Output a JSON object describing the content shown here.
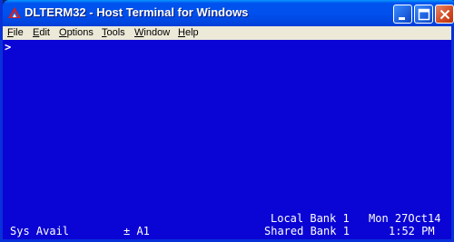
{
  "window": {
    "title": "DLTERM32 - Host Terminal for Windows",
    "icon": "delta-triangle-icon",
    "buttons": [
      "minimize-icon",
      "maximize-icon",
      "close-icon"
    ]
  },
  "menu": {
    "items": [
      {
        "first": "F",
        "rest": "ile"
      },
      {
        "first": "E",
        "rest": "dit"
      },
      {
        "first": "O",
        "rest": "ptions"
      },
      {
        "first": "T",
        "rest": "ools"
      },
      {
        "first": "W",
        "rest": "indow"
      },
      {
        "first": "H",
        "rest": "elp"
      }
    ]
  },
  "terminal": {
    "prompt": ">",
    "status": {
      "sys_avail": "Sys Avail",
      "indicator": "± A1",
      "local_bank": "Local Bank 1",
      "shared_bank": "Shared Bank 1",
      "date": "Mon 27Oct14",
      "time": "1:52 PM"
    }
  },
  "colors": {
    "terminal_bg": "#0a04d4",
    "titlebar": "#0050ee",
    "menubar_bg": "#ece9d8"
  }
}
